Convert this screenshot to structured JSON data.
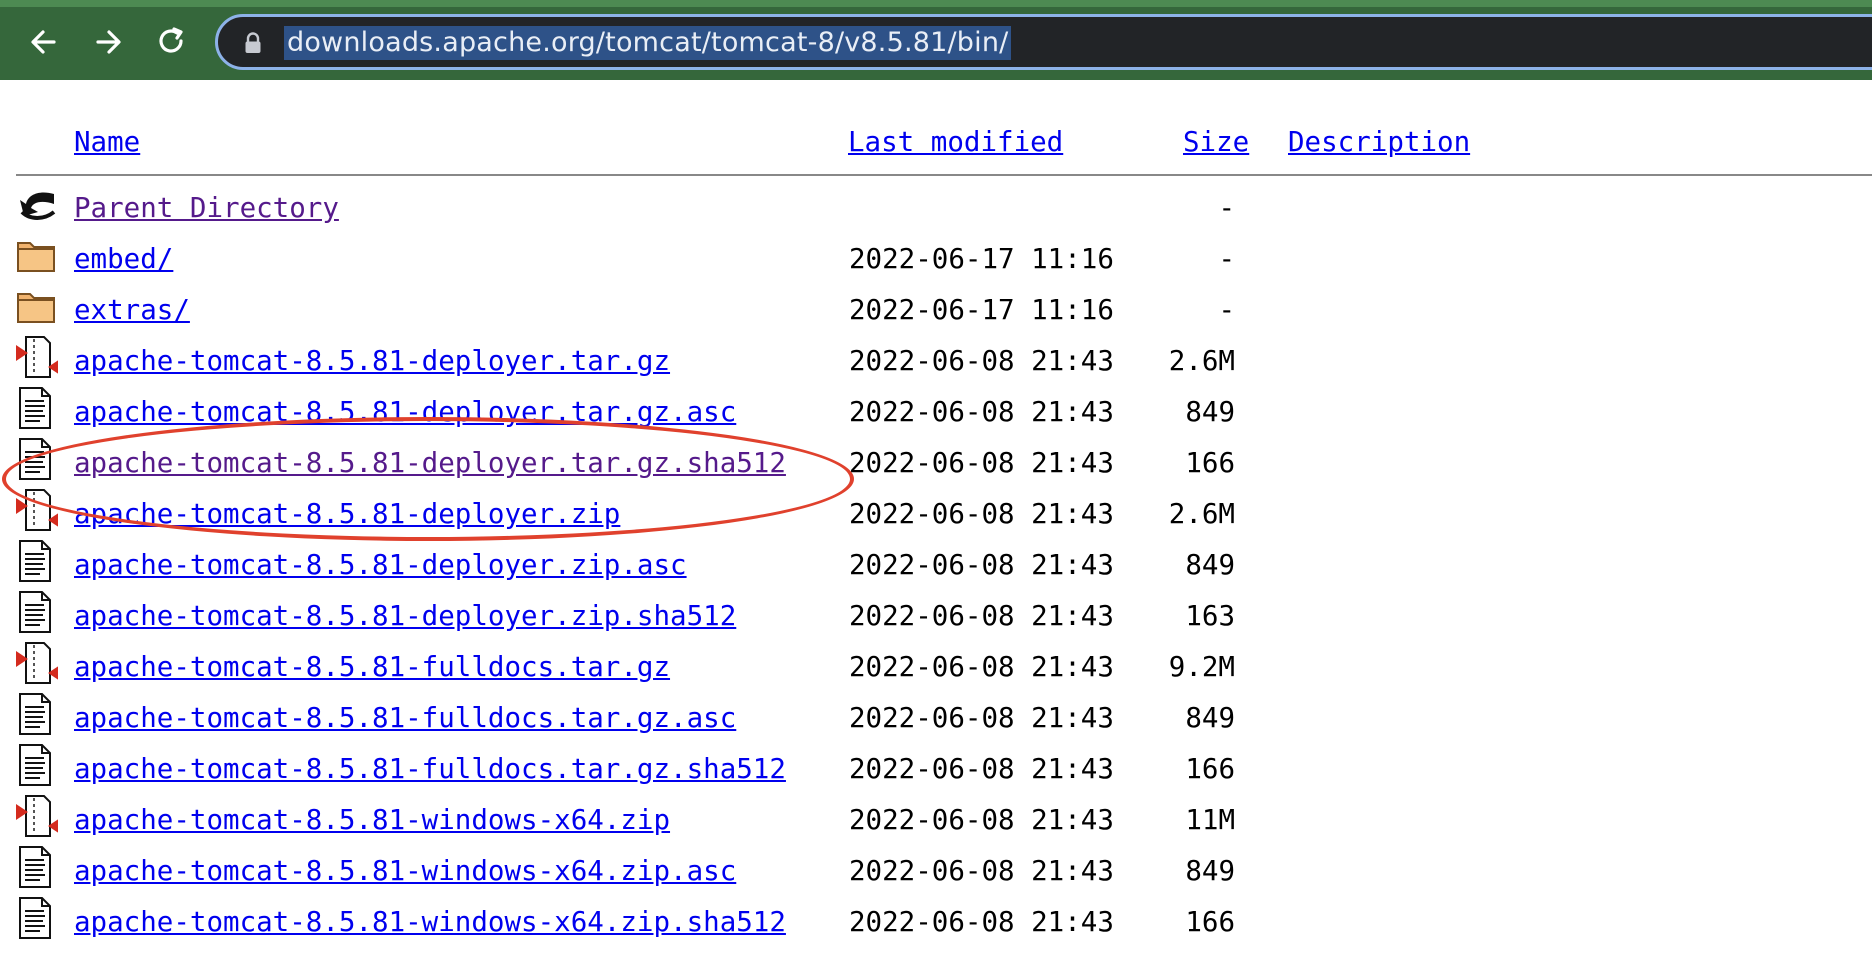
{
  "browser": {
    "url": "downloads.apache.org/tomcat/tomcat-8/v8.5.81/bin/",
    "colors": {
      "toolbar": "#35673b",
      "omnibox": "#222427",
      "selection": "#2e5288"
    }
  },
  "table": {
    "headers": {
      "name": "Name",
      "last_modified": "Last modified",
      "size": "Size",
      "description": "Description"
    },
    "rows": [
      {
        "icon": "back-icon",
        "name": "Parent Directory",
        "date": "",
        "size": "-",
        "visited": true
      },
      {
        "icon": "folder-icon",
        "name": "embed/",
        "date": "2022-06-17 11:16",
        "size": "-",
        "visited": false
      },
      {
        "icon": "folder-icon",
        "name": "extras/",
        "date": "2022-06-17 11:16",
        "size": "-",
        "visited": false
      },
      {
        "icon": "compressed-icon",
        "name": "apache-tomcat-8.5.81-deployer.tar.gz",
        "date": "2022-06-08 21:43",
        "size": "2.6M",
        "visited": false
      },
      {
        "icon": "text-file-icon",
        "name": "apache-tomcat-8.5.81-deployer.tar.gz.asc",
        "date": "2022-06-08 21:43",
        "size": "849",
        "visited": false
      },
      {
        "icon": "text-file-icon",
        "name": "apache-tomcat-8.5.81-deployer.tar.gz.sha512",
        "date": "2022-06-08 21:43",
        "size": "166",
        "visited": true
      },
      {
        "icon": "compressed-icon",
        "name": "apache-tomcat-8.5.81-deployer.zip",
        "date": "2022-06-08 21:43",
        "size": "2.6M",
        "visited": false
      },
      {
        "icon": "text-file-icon",
        "name": "apache-tomcat-8.5.81-deployer.zip.asc",
        "date": "2022-06-08 21:43",
        "size": "849",
        "visited": false
      },
      {
        "icon": "text-file-icon",
        "name": "apache-tomcat-8.5.81-deployer.zip.sha512",
        "date": "2022-06-08 21:43",
        "size": "163",
        "visited": false
      },
      {
        "icon": "compressed-icon",
        "name": "apache-tomcat-8.5.81-fulldocs.tar.gz",
        "date": "2022-06-08 21:43",
        "size": "9.2M",
        "visited": false
      },
      {
        "icon": "text-file-icon",
        "name": "apache-tomcat-8.5.81-fulldocs.tar.gz.asc",
        "date": "2022-06-08 21:43",
        "size": "849",
        "visited": false
      },
      {
        "icon": "text-file-icon",
        "name": "apache-tomcat-8.5.81-fulldocs.tar.gz.sha512",
        "date": "2022-06-08 21:43",
        "size": "166",
        "visited": false
      },
      {
        "icon": "compressed-icon",
        "name": "apache-tomcat-8.5.81-windows-x64.zip",
        "date": "2022-06-08 21:43",
        "size": "11M",
        "visited": false
      },
      {
        "icon": "text-file-icon",
        "name": "apache-tomcat-8.5.81-windows-x64.zip.asc",
        "date": "2022-06-08 21:43",
        "size": "849",
        "visited": false
      },
      {
        "icon": "text-file-icon",
        "name": "apache-tomcat-8.5.81-windows-x64.zip.sha512",
        "date": "2022-06-08 21:43",
        "size": "166",
        "visited": false
      }
    ]
  },
  "annotation": {
    "color": "#e0412d",
    "highlighted_row": "apache-tomcat-8.5.81-deployer.tar.gz.sha512"
  }
}
